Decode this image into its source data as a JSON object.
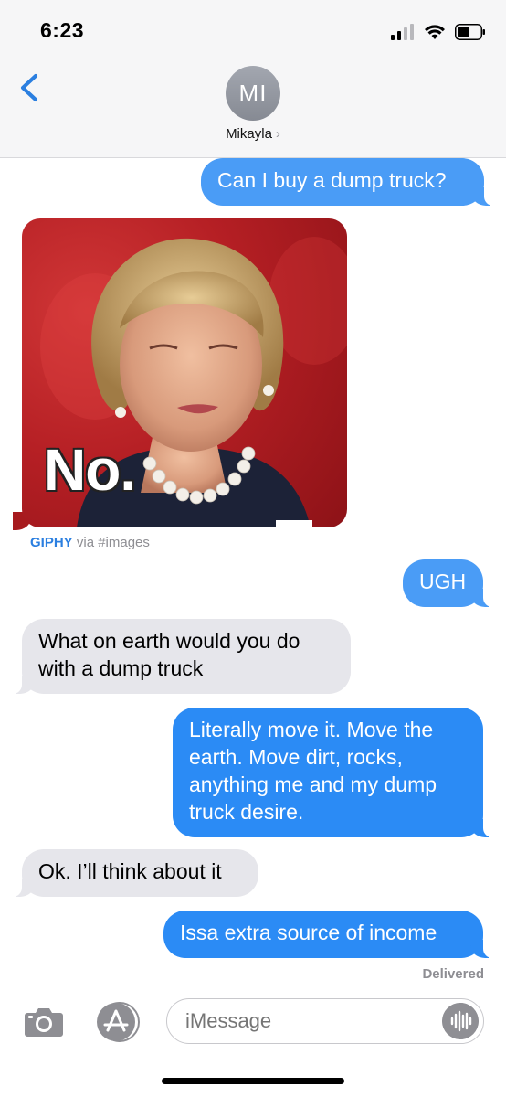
{
  "status": {
    "time": "6:23"
  },
  "header": {
    "avatar_initials": "MI",
    "contact_name": "Mikayla",
    "contact_chevron": "›"
  },
  "messages": [
    {
      "direction": "sent",
      "text": "Can I buy a dump truck?"
    },
    {
      "direction": "received",
      "type": "gif",
      "overlay_text": "No.",
      "caption_brand": "GIPHY",
      "caption_rest": " via #images"
    },
    {
      "direction": "sent",
      "text": "UGH"
    },
    {
      "direction": "received",
      "text": "What on earth would you do with a dump truck"
    },
    {
      "direction": "sent",
      "text": "Literally move it. Move the earth. Move dirt, rocks, anything me and my dump truck desire."
    },
    {
      "direction": "received",
      "text": "Ok. I’ll think about it"
    },
    {
      "direction": "sent",
      "text": "Issa extra source of income"
    }
  ],
  "delivery_status": "Delivered",
  "composer": {
    "placeholder": "iMessage"
  },
  "colors": {
    "sent_bubble": "#2b8bf5",
    "received_bubble": "#e6e6eb",
    "accent": "#2b7fe0"
  }
}
